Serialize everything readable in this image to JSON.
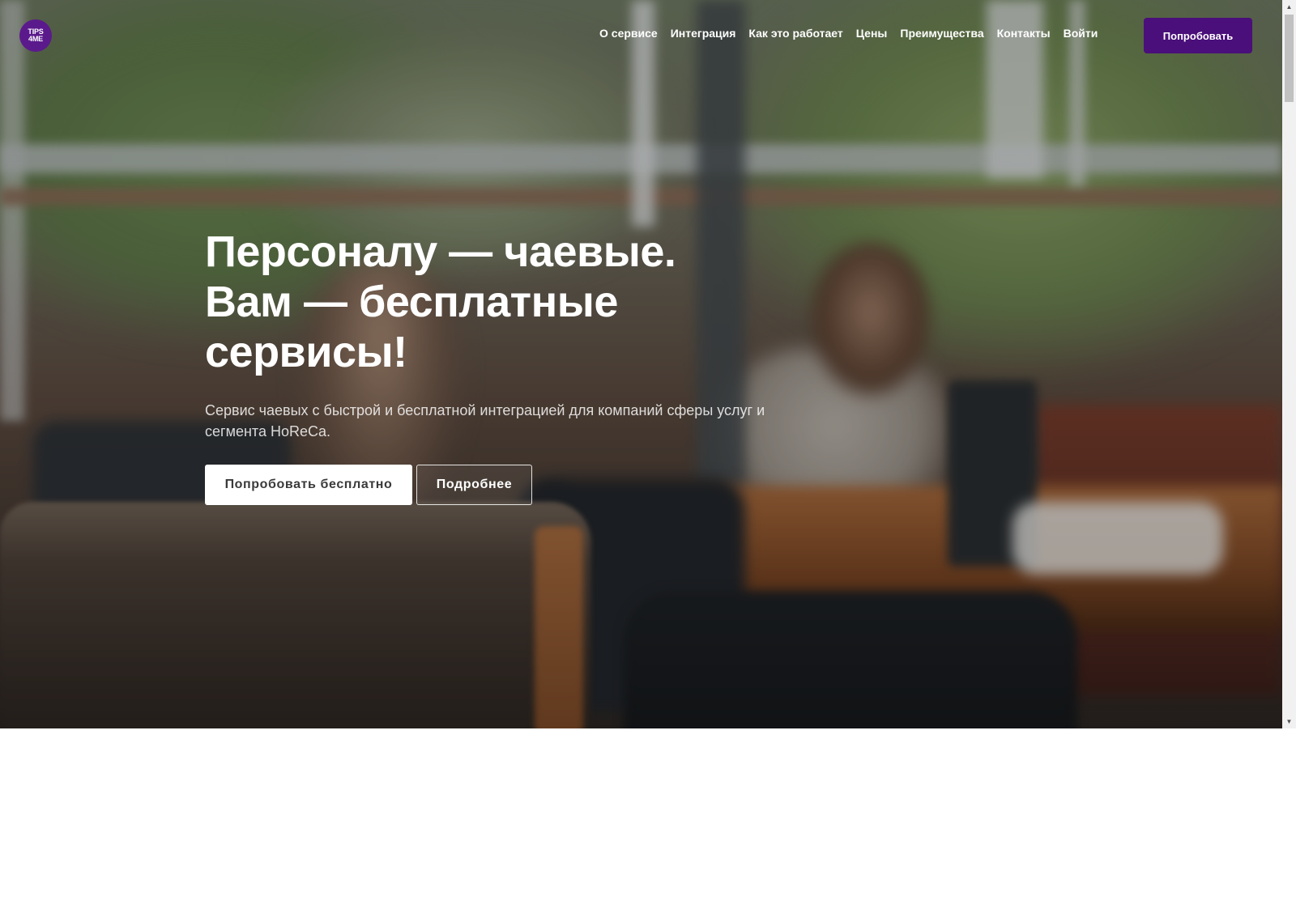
{
  "nav": {
    "logo_line1": "TIPS",
    "logo_line2": "4ME",
    "brand_color": "#4a0f7a",
    "items": [
      {
        "label": "О сервисе"
      },
      {
        "label": "Интеграция"
      },
      {
        "label": "Как это работает"
      },
      {
        "label": "Цены"
      },
      {
        "label": "Преимущества"
      },
      {
        "label": "Контакты"
      },
      {
        "label": "Войти"
      }
    ],
    "cta_label": "Попробовать"
  },
  "hero": {
    "headline_lines": [
      "Персоналу — чаевые.",
      "Вам — бесплатные",
      "сервисы!"
    ],
    "subtitle": "Сервис чаевых с быстрой и бесплатной интеграцией для компаний сферы услуг и сегмента HoReCa.",
    "primary_button": "Попробовать бесплатно",
    "secondary_button": "Подробнее",
    "background_image": "blurred-restaurant-photo"
  },
  "scrollbar": {
    "up_icon": "triangle-up-icon",
    "down_icon": "triangle-down-icon"
  }
}
